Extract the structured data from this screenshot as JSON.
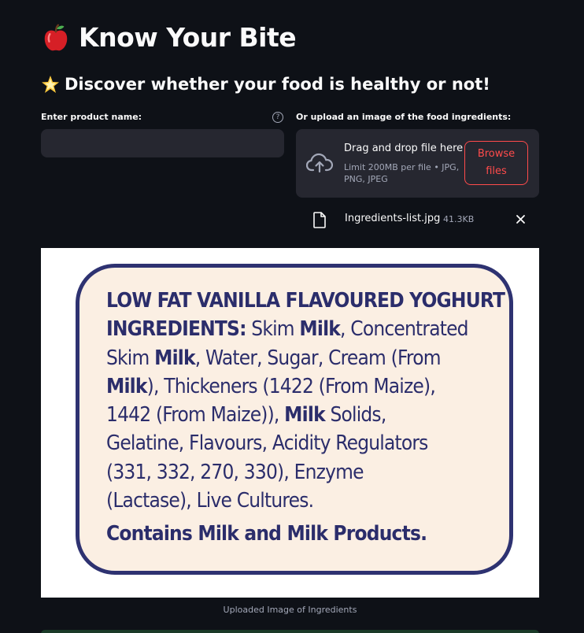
{
  "header": {
    "title": "Know Your Bite",
    "subtitle": "Discover whether your food is healthy or not!"
  },
  "product_input": {
    "label": "Enter product name:",
    "value": "",
    "help_icon": "question-circle-icon"
  },
  "uploader": {
    "label": "Or upload an image of the food ingredients:",
    "drag_text": "Drag and drop file here",
    "limit_text": "Limit 200MB per file • JPG, PNG, JPEG",
    "browse_label": "Browse\nfiles",
    "accent_color": "#ff4b4b"
  },
  "uploaded_file": {
    "name": "Ingredients-list.jpg",
    "size": "41.3KB"
  },
  "ingredients_image": {
    "heading": "LOW FAT VANILLA FLAVOURED YOGHURT",
    "ingredients_label": "INGREDIENTS:",
    "lines": [
      [
        "Skim ",
        "Milk",
        ", Concentrated"
      ],
      [
        "Skim ",
        "Milk",
        ", Water, Sugar, Cream (From"
      ],
      [
        "",
        "Milk",
        "), Thickeners (1422 (From Maize),"
      ],
      [
        "1442 (From Maize)), ",
        "Milk",
        " Solids,"
      ],
      [
        "Gelatine, Flavours, Acidity Regulators",
        "",
        ""
      ],
      [
        "(331, 332, 270, 330), Enzyme",
        "",
        ""
      ],
      [
        "(Lactase), Live Cultures.",
        "",
        ""
      ]
    ],
    "contains": "Contains Milk and Milk Products."
  },
  "caption": "Uploaded Image of Ingredients",
  "theme": {
    "background": "#0e1117",
    "input_bg": "#262730",
    "label_ink": "#2e3271",
    "label_paper": "#fbefe3"
  }
}
